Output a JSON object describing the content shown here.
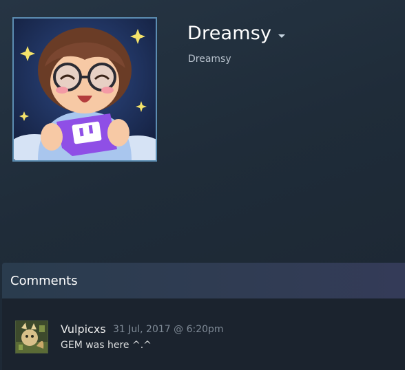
{
  "profile": {
    "persona_name": "Dreamsy",
    "real_name": "Dreamsy",
    "avatar_icon": "cartoon-avatar-with-twitch-controller"
  },
  "comments": {
    "title": "Comments",
    "items": [
      {
        "author": "Vulpicxs",
        "timestamp": "31 Jul, 2017 @ 6:20pm",
        "text": "GEM was here ^.^",
        "avatar_icon": "fox-artwork-avatar"
      }
    ]
  },
  "colors": {
    "avatar_border": "#5c8db2",
    "twitch_purple": "#8f4fe6",
    "background_dark": "#1b232e"
  }
}
